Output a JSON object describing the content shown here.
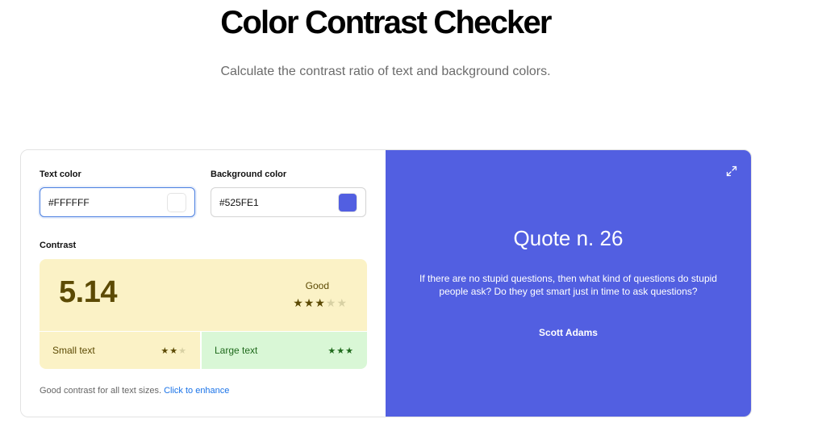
{
  "header": {
    "title": "Color Contrast Checker",
    "subtitle": "Calculate the contrast ratio of text and background colors."
  },
  "inputs": {
    "text_color": {
      "label": "Text color",
      "value": "#FFFFFF"
    },
    "background_color": {
      "label": "Background color",
      "value": "#525FE1"
    }
  },
  "contrast": {
    "label": "Contrast",
    "ratio": "5.14",
    "rating": "Good",
    "rating_stars": 3,
    "rating_stars_max": 5,
    "small_text": {
      "label": "Small text",
      "stars": 2,
      "max": 3
    },
    "large_text": {
      "label": "Large text",
      "stars": 3,
      "max": 3
    },
    "note": "Good contrast for all text sizes.",
    "enhance_link": "Click to enhance"
  },
  "preview": {
    "title": "Quote n. 26",
    "quote": "If there are no stupid questions, then what kind of questions do stupid people ask? Do they get smart just in time to ask questions?",
    "author": "Scott Adams"
  },
  "colors": {
    "text": "#FFFFFF",
    "background": "#525FE1",
    "good_bg": "#FBF2C6",
    "good_fg": "#5C4A04",
    "great_bg": "#D9F7D6",
    "great_fg": "#1F6A1C",
    "link": "#1A73E8"
  },
  "icons": {
    "expand": "expand-arrows-icon",
    "star": "star-icon"
  }
}
